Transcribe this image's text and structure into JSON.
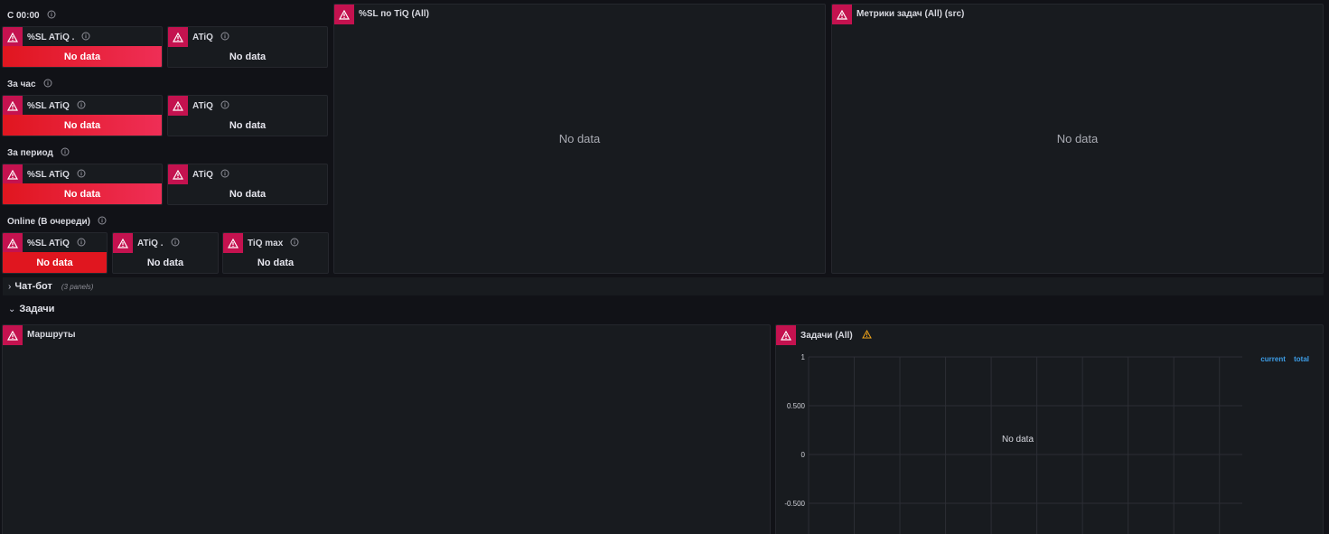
{
  "sections": {
    "s0000": "С 00:00",
    "hour": "За час",
    "period": "За период",
    "online": "Online (В очереди)"
  },
  "stats": {
    "r1a": {
      "title": "%SL ATiQ .",
      "value": "No data"
    },
    "r1b": {
      "title": "ATiQ",
      "value": "No data"
    },
    "r2a": {
      "title": "%SL ATiQ",
      "value": "No data"
    },
    "r2b": {
      "title": "ATiQ",
      "value": "No data"
    },
    "r3a": {
      "title": "%SL ATiQ",
      "value": "No data"
    },
    "r3b": {
      "title": "ATiQ",
      "value": "No data"
    },
    "r4a": {
      "title": "%SL ATiQ",
      "value": "No data"
    },
    "r4b": {
      "title": "ATiQ .",
      "value": "No data"
    },
    "r4c": {
      "title": "TiQ max",
      "value": "No data"
    }
  },
  "panels": {
    "sl_tiq": {
      "title": "%SL по TiQ (All)",
      "value": "No data"
    },
    "task_metrics": {
      "title": "Метрики задач (All) (src)",
      "value": "No data"
    },
    "routes": {
      "title": "Маршруты"
    },
    "tasks": {
      "title": "Задачи (All)",
      "value": "No data",
      "legend": [
        "current",
        "total"
      ]
    }
  },
  "rows": {
    "chatbot": {
      "title": "Чат-бот",
      "count": "(3 panels)"
    },
    "tasks": {
      "title": "Задачи"
    }
  },
  "chart_data": {
    "type": "line",
    "title": "Задачи (All)",
    "series": [],
    "yticks": [
      "1",
      "0.500",
      "0",
      "-0.500"
    ],
    "ylim": [
      -0.5,
      1
    ],
    "grid": true,
    "legend_placement": "top-right",
    "colors": {
      "legend": "#3d9ee8",
      "warning": "#c4124f"
    }
  },
  "colors": {
    "background": "#111217",
    "panel": "#181b1f",
    "error_badge": "#c4124f",
    "stat_red": "#e0161f"
  }
}
